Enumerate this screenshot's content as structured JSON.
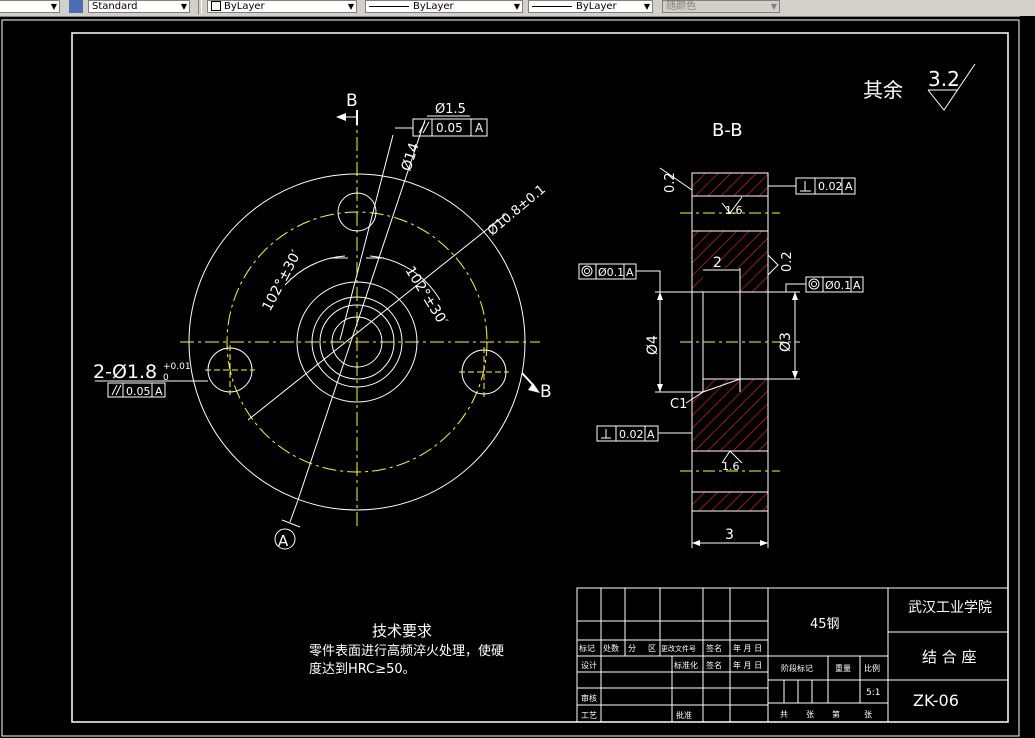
{
  "toolbar": {
    "textstyle": "Standard",
    "layer": "ByLayer",
    "linetype": "ByLayer",
    "lineweight": "ByLayer",
    "color": "随颜色"
  },
  "drawing": {
    "roughness_label": "其余",
    "roughness_value": "3.2",
    "section_title": "B-B",
    "section_letter": "B",
    "datum_a": "A",
    "tol_parallel": "0.05",
    "tol_perp": "0.02",
    "tol_conc": "Ø0.1",
    "dim_phi15": "Ø1.5",
    "dim_phi14": "Ø14",
    "dim_phi108": "Ø10.8±0.1",
    "dim_angle": "102°±30′",
    "dim_holes": "2-Ø1.8",
    "dim_holes_tol": "+0.01",
    "dim_holes_tol0": "0",
    "dim_phi4": "Ø4",
    "dim_phi3": "Ø3",
    "dim_2": "2",
    "dim_3": "3",
    "dim_02": "0.2",
    "dim_c1": "C1",
    "rough_16": "1.6",
    "notes_title": "技术要求",
    "notes_line1": "零件表面进行高频淬火处理，使硬",
    "notes_line2": "度达到HRC≥50。"
  },
  "title_block": {
    "material": "45钢",
    "school": "武汉工业学院",
    "part_name": "结 合 座",
    "drawing_no": "ZK-06",
    "scale": "5:1",
    "h_mark": "标记",
    "h_count": "处数",
    "h_div": "分",
    "h_zone": "区",
    "h_docno": "更改文件号",
    "h_sign": "签名",
    "h_date": "年 月 日",
    "h_design": "设计",
    "h_std": "标准化",
    "h_stage": "阶段标记",
    "h_weight": "重量",
    "h_ratio": "比例",
    "h_check": "审核",
    "h_process": "工艺",
    "h_approve": "批准",
    "h_total": "共",
    "h_sheets": "张",
    "h_nth": "第",
    "h_sheet": "张"
  }
}
